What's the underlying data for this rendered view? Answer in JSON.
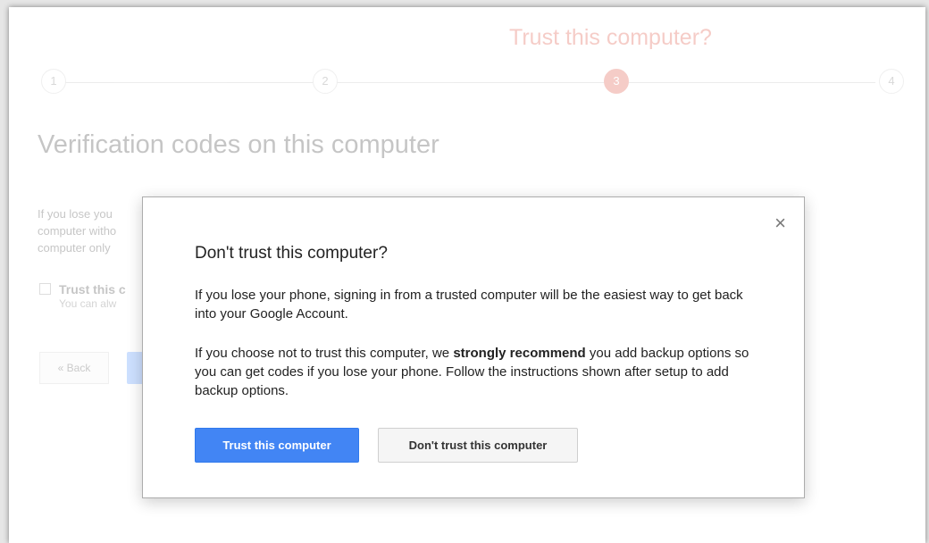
{
  "background": {
    "step_title": "Trust this computer?",
    "steps": [
      "1",
      "2",
      "3",
      "4"
    ],
    "heading": "Verification codes on this computer",
    "text_lines": [
      "If you lose you",
      "computer witho",
      "computer only"
    ],
    "trust_label": "Trust this c",
    "trust_sub": "You can alw",
    "back_label": "« Back"
  },
  "modal": {
    "close": "×",
    "title": "Don't trust this computer?",
    "p1": "If you lose your phone, signing in from a trusted computer will be the easiest way to get back into your Google Account.",
    "p2_before": "If you choose not to trust this computer, we ",
    "p2_bold": "strongly recommend",
    "p2_after": " you add backup options so you can get codes if you lose your phone. Follow the instructions shown after setup to add backup options.",
    "primary_label": "Trust this computer",
    "secondary_label": "Don't trust this computer"
  },
  "colors": {
    "accent": "#dd4b39",
    "primary_button": "#4285f4"
  }
}
